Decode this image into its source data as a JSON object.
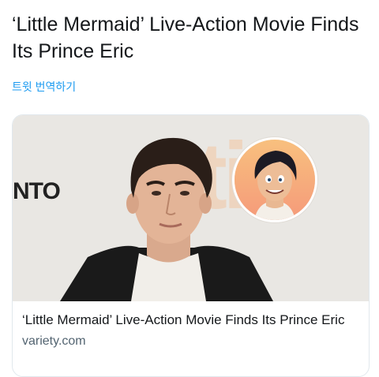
{
  "tweet": {
    "text": "‘Little Mermaid’ Live-Action Movie Finds Its Prince Eric",
    "translate_label": "트윗 번역하기"
  },
  "card": {
    "title": "‘Little Mermaid’ Live-Action Movie Finds Its Prince Eric",
    "domain": "variety.com",
    "backdrop_text_left": "NTO",
    "backdrop_text_right": "tif",
    "image_subject": "portrait-photo",
    "avatar_subject": "cartoon-prince"
  },
  "colors": {
    "link_blue": "#1d9bf0",
    "text_dark": "#14171a",
    "muted": "#536471",
    "card_border": "#e1e8ed"
  }
}
